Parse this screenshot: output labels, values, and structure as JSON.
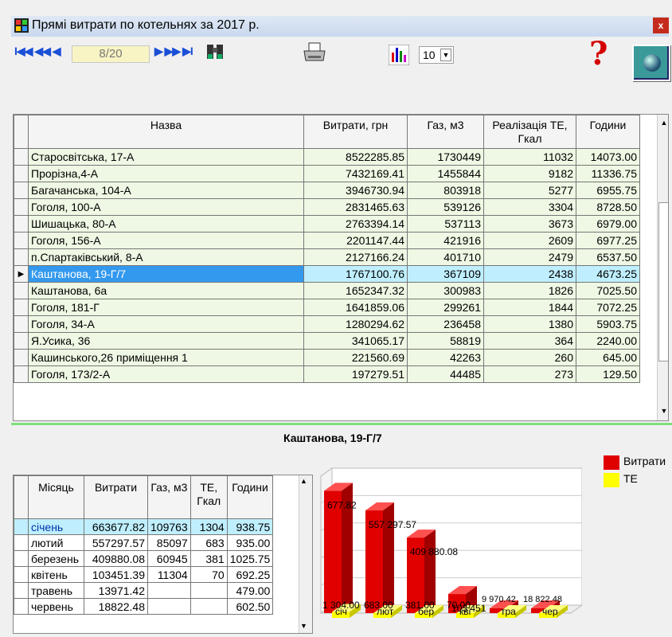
{
  "window": {
    "title": "Прямі витрати по котельнях  за  2017  р.",
    "close": "x"
  },
  "toolbar": {
    "nav_left": "I◀◀ ◀◀ ◀",
    "page": "8/20",
    "nav_right": "▶ ▶▶ ▶I",
    "rows_select": "10",
    "help": "?"
  },
  "grid": {
    "headers": {
      "name": "Назва",
      "cost": "Витрати, грн",
      "gas": "Газ, м3",
      "te": "Реалізація ТЕ, Гкал",
      "hours": "Години"
    },
    "rows": [
      {
        "name": "Старосвітська, 17-А",
        "cost": "8522285.85",
        "gas": "1730449",
        "te": "11032",
        "hours": "14073.00"
      },
      {
        "name": "Прорізна,4-А",
        "cost": "7432169.41",
        "gas": "1455844",
        "te": "9182",
        "hours": "11336.75"
      },
      {
        "name": "Багачанська, 104-А",
        "cost": "3946730.94",
        "gas": "803918",
        "te": "5277",
        "hours": "6955.75"
      },
      {
        "name": "Гоголя, 100-А",
        "cost": "2831465.63",
        "gas": "539126",
        "te": "3304",
        "hours": "8728.50"
      },
      {
        "name": "Шишацька, 80-А",
        "cost": "2763394.14",
        "gas": "537113",
        "te": "3673",
        "hours": "6979.00"
      },
      {
        "name": "Гоголя, 156-А",
        "cost": "2201147.44",
        "gas": "421916",
        "te": "2609",
        "hours": "6977.25"
      },
      {
        "name": "п.Спартаківський, 8-А",
        "cost": "2127166.24",
        "gas": "401710",
        "te": "2479",
        "hours": "6537.50"
      },
      {
        "name": "Каштанова, 19-Г/7",
        "cost": "1767100.76",
        "gas": "367109",
        "te": "2438",
        "hours": "4673.25"
      },
      {
        "name": "Каштанова, 6а",
        "cost": "1652347.32",
        "gas": "300983",
        "te": "1826",
        "hours": "7025.50"
      },
      {
        "name": "Гоголя, 181-Г",
        "cost": "1641859.06",
        "gas": "299261",
        "te": "1844",
        "hours": "7072.25"
      },
      {
        "name": "Гоголя, 34-А",
        "cost": "1280294.62",
        "gas": "236458",
        "te": "1380",
        "hours": "5903.75"
      },
      {
        "name": "Я.Усика, 36",
        "cost": "341065.17",
        "gas": "58819",
        "te": "364",
        "hours": "2240.00"
      },
      {
        "name": "Кашинського,26 приміщення 1",
        "cost": "221560.69",
        "gas": "42263",
        "te": "260",
        "hours": "645.00"
      },
      {
        "name": "Гоголя, 173/2-А",
        "cost": "197279.51",
        "gas": "44485",
        "te": "273",
        "hours": "129.50"
      }
    ]
  },
  "detail": {
    "title": "Каштанова, 19-Г/7",
    "headers": {
      "month": "Місяць",
      "cost": "Витрати",
      "gas": "Газ, м3",
      "te": "ТЕ, Гкал",
      "hours": "Години"
    },
    "rows": [
      {
        "month": "січень",
        "cost": "663677.82",
        "gas": "109763",
        "te": "1304",
        "hours": "938.75"
      },
      {
        "month": "лютий",
        "cost": "557297.57",
        "gas": "85097",
        "te": "683",
        "hours": "935.00"
      },
      {
        "month": "березень",
        "cost": "409880.08",
        "gas": "60945",
        "te": "381",
        "hours": "1025.75"
      },
      {
        "month": "квітень",
        "cost": "103451.39",
        "gas": "11304",
        "te": "70",
        "hours": "692.25"
      },
      {
        "month": "травень",
        "cost": "13971.42",
        "gas": "",
        "te": "",
        "hours": "479.00"
      },
      {
        "month": "червень",
        "cost": "18822.48",
        "gas": "",
        "te": "",
        "hours": "602.50"
      }
    ]
  },
  "chart_data": {
    "type": "bar",
    "categories": [
      "січ",
      "лют",
      "бер",
      "кві",
      "тра",
      "чер"
    ],
    "series": [
      {
        "name": "Витрати",
        "color": "#e00000",
        "values": [
          663677.82,
          557297.57,
          409880.08,
          103451.39,
          13971.42,
          18822.48
        ],
        "labels": [
          "677.82",
          "557 297.57",
          "409 880.08",
          "103 451",
          "",
          ""
        ]
      },
      {
        "name": "ТЕ",
        "color": "#ffff00",
        "values": [
          1304,
          683,
          381,
          70,
          0,
          0
        ],
        "labels": [
          "1 304.00",
          "683.00",
          "381.00",
          "70.00",
          "",
          ""
        ]
      }
    ],
    "extra_labels": [
      "9 970.42",
      "18 822.48"
    ],
    "grid": true,
    "legend": "right"
  }
}
